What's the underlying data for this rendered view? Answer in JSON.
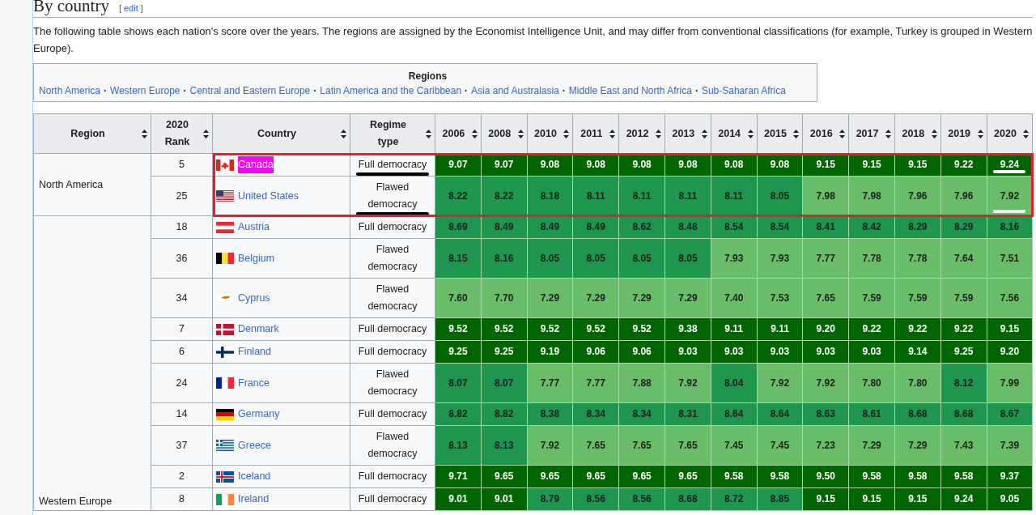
{
  "heading": {
    "title": "By country",
    "edit_brackets": [
      "[",
      "]"
    ],
    "edit_link": "edit"
  },
  "intro": "The following table shows each nation's score over the years. The regions are assigned by the Economist Intelligence Unit, and may differ from conventional classifications (for example, Turkey is grouped in Western Europe).",
  "regions_box": {
    "title": "Regions",
    "separator": "·",
    "links": [
      "North America",
      "Western Europe",
      "Central and Eastern Europe",
      "Latin America and the Caribbean",
      "Asia and Australasia",
      "Middle East and North Africa",
      "Sub-Saharan Africa"
    ]
  },
  "table": {
    "columns": [
      "Region",
      "2020 Rank",
      "Country",
      "Regime type",
      "2006",
      "2008",
      "2010",
      "2011",
      "2012",
      "2013",
      "2014",
      "2015",
      "2016",
      "2017",
      "2018",
      "2019",
      "2020"
    ],
    "regions": [
      {
        "name": "North America",
        "rows": [
          {
            "rank": "5",
            "country": "Canada",
            "flag": {
              "kind": "ca"
            },
            "highlighted": true,
            "regime": "Full democracy",
            "regime_underlined": true,
            "boxed": true,
            "scores": [
              {
                "v": "9.07",
                "color": "#006400"
              },
              {
                "v": "9.07",
                "color": "#006400"
              },
              {
                "v": "9.08",
                "color": "#006400"
              },
              {
                "v": "9.08",
                "color": "#006400"
              },
              {
                "v": "9.08",
                "color": "#006400"
              },
              {
                "v": "9.08",
                "color": "#006400"
              },
              {
                "v": "9.08",
                "color": "#006400"
              },
              {
                "v": "9.08",
                "color": "#006400"
              },
              {
                "v": "9.15",
                "color": "#006400"
              },
              {
                "v": "9.15",
                "color": "#006400"
              },
              {
                "v": "9.15",
                "color": "#006400"
              },
              {
                "v": "9.22",
                "color": "#006400"
              },
              {
                "v": "9.24",
                "color": "#006400",
                "underlined": true
              }
            ]
          },
          {
            "rank": "25",
            "country": "United States",
            "flag": {
              "kind": "us"
            },
            "highlighted": false,
            "regime": "Flawed democracy",
            "regime_underlined": true,
            "boxed": true,
            "scores": [
              {
                "v": "8.22",
                "color": "#1e9650"
              },
              {
                "v": "8.22",
                "color": "#1e9650"
              },
              {
                "v": "8.18",
                "color": "#1e9650"
              },
              {
                "v": "8.11",
                "color": "#1e9650"
              },
              {
                "v": "8.11",
                "color": "#1e9650"
              },
              {
                "v": "8.11",
                "color": "#1e9650"
              },
              {
                "v": "8.11",
                "color": "#1e9650"
              },
              {
                "v": "8.05",
                "color": "#1e9650"
              },
              {
                "v": "7.98",
                "color": "#69bd69"
              },
              {
                "v": "7.98",
                "color": "#69bd69"
              },
              {
                "v": "7.96",
                "color": "#69bd69"
              },
              {
                "v": "7.96",
                "color": "#69bd69"
              },
              {
                "v": "7.92",
                "color": "#69bd69",
                "underlined": true
              }
            ]
          }
        ]
      },
      {
        "name": "Western Europe",
        "rows": [
          {
            "rank": "18",
            "country": "Austria",
            "flag": {
              "kind": "at"
            },
            "highlighted": false,
            "regime": "Full democracy",
            "regime_underlined": false,
            "boxed": false,
            "scores": [
              {
                "v": "8.69",
                "color": "#1e9650"
              },
              {
                "v": "8.49",
                "color": "#1e9650"
              },
              {
                "v": "8.49",
                "color": "#1e9650"
              },
              {
                "v": "8.49",
                "color": "#1e9650"
              },
              {
                "v": "8.62",
                "color": "#1e9650"
              },
              {
                "v": "8.48",
                "color": "#1e9650"
              },
              {
                "v": "8.54",
                "color": "#1e9650"
              },
              {
                "v": "8.54",
                "color": "#1e9650"
              },
              {
                "v": "8.41",
                "color": "#1e9650"
              },
              {
                "v": "8.42",
                "color": "#1e9650"
              },
              {
                "v": "8.29",
                "color": "#1e9650"
              },
              {
                "v": "8.29",
                "color": "#1e9650"
              },
              {
                "v": "8.16",
                "color": "#1e9650"
              }
            ]
          },
          {
            "rank": "36",
            "country": "Belgium",
            "flag": {
              "kind": "be"
            },
            "highlighted": false,
            "regime": "Flawed democracy",
            "regime_underlined": false,
            "boxed": false,
            "scores": [
              {
                "v": "8.15",
                "color": "#1e9650"
              },
              {
                "v": "8.16",
                "color": "#1e9650"
              },
              {
                "v": "8.05",
                "color": "#1e9650"
              },
              {
                "v": "8.05",
                "color": "#1e9650"
              },
              {
                "v": "8.05",
                "color": "#1e9650"
              },
              {
                "v": "8.05",
                "color": "#1e9650"
              },
              {
                "v": "7.93",
                "color": "#69bd69"
              },
              {
                "v": "7.93",
                "color": "#69bd69"
              },
              {
                "v": "7.77",
                "color": "#69bd69"
              },
              {
                "v": "7.78",
                "color": "#69bd69"
              },
              {
                "v": "7.78",
                "color": "#69bd69"
              },
              {
                "v": "7.64",
                "color": "#69bd69"
              },
              {
                "v": "7.51",
                "color": "#69bd69"
              }
            ]
          },
          {
            "rank": "34",
            "country": "Cyprus",
            "flag": {
              "kind": "cy"
            },
            "highlighted": false,
            "regime": "Flawed democracy",
            "regime_underlined": false,
            "boxed": false,
            "scores": [
              {
                "v": "7.60",
                "color": "#69bd69"
              },
              {
                "v": "7.70",
                "color": "#69bd69"
              },
              {
                "v": "7.29",
                "color": "#69bd69"
              },
              {
                "v": "7.29",
                "color": "#69bd69"
              },
              {
                "v": "7.29",
                "color": "#69bd69"
              },
              {
                "v": "7.29",
                "color": "#69bd69"
              },
              {
                "v": "7.40",
                "color": "#69bd69"
              },
              {
                "v": "7.53",
                "color": "#69bd69"
              },
              {
                "v": "7.65",
                "color": "#69bd69"
              },
              {
                "v": "7.59",
                "color": "#69bd69"
              },
              {
                "v": "7.59",
                "color": "#69bd69"
              },
              {
                "v": "7.59",
                "color": "#69bd69"
              },
              {
                "v": "7.56",
                "color": "#69bd69"
              }
            ]
          },
          {
            "rank": "7",
            "country": "Denmark",
            "flag": {
              "kind": "dk"
            },
            "highlighted": false,
            "regime": "Full democracy",
            "regime_underlined": false,
            "boxed": false,
            "scores": [
              {
                "v": "9.52",
                "color": "#006400"
              },
              {
                "v": "9.52",
                "color": "#006400"
              },
              {
                "v": "9.52",
                "color": "#006400"
              },
              {
                "v": "9.52",
                "color": "#006400"
              },
              {
                "v": "9.52",
                "color": "#006400"
              },
              {
                "v": "9.38",
                "color": "#006400"
              },
              {
                "v": "9.11",
                "color": "#006400"
              },
              {
                "v": "9.11",
                "color": "#006400"
              },
              {
                "v": "9.20",
                "color": "#006400"
              },
              {
                "v": "9.22",
                "color": "#006400"
              },
              {
                "v": "9.22",
                "color": "#006400"
              },
              {
                "v": "9.22",
                "color": "#006400"
              },
              {
                "v": "9.15",
                "color": "#006400"
              }
            ]
          },
          {
            "rank": "6",
            "country": "Finland",
            "flag": {
              "kind": "fi"
            },
            "highlighted": false,
            "regime": "Full democracy",
            "regime_underlined": false,
            "boxed": false,
            "scores": [
              {
                "v": "9.25",
                "color": "#006400"
              },
              {
                "v": "9.25",
                "color": "#006400"
              },
              {
                "v": "9.19",
                "color": "#006400"
              },
              {
                "v": "9.06",
                "color": "#006400"
              },
              {
                "v": "9.06",
                "color": "#006400"
              },
              {
                "v": "9.03",
                "color": "#006400"
              },
              {
                "v": "9.03",
                "color": "#006400"
              },
              {
                "v": "9.03",
                "color": "#006400"
              },
              {
                "v": "9.03",
                "color": "#006400"
              },
              {
                "v": "9.03",
                "color": "#006400"
              },
              {
                "v": "9.14",
                "color": "#006400"
              },
              {
                "v": "9.25",
                "color": "#006400"
              },
              {
                "v": "9.20",
                "color": "#006400"
              }
            ]
          },
          {
            "rank": "24",
            "country": "France",
            "flag": {
              "kind": "fr"
            },
            "highlighted": false,
            "regime": "Flawed democracy",
            "regime_underlined": false,
            "boxed": false,
            "scores": [
              {
                "v": "8.07",
                "color": "#1e9650"
              },
              {
                "v": "8.07",
                "color": "#1e9650"
              },
              {
                "v": "7.77",
                "color": "#69bd69"
              },
              {
                "v": "7.77",
                "color": "#69bd69"
              },
              {
                "v": "7.88",
                "color": "#69bd69"
              },
              {
                "v": "7.92",
                "color": "#69bd69"
              },
              {
                "v": "8.04",
                "color": "#1e9650"
              },
              {
                "v": "7.92",
                "color": "#69bd69"
              },
              {
                "v": "7.92",
                "color": "#69bd69"
              },
              {
                "v": "7.80",
                "color": "#69bd69"
              },
              {
                "v": "7.80",
                "color": "#69bd69"
              },
              {
                "v": "8.12",
                "color": "#1e9650"
              },
              {
                "v": "7.99",
                "color": "#69bd69"
              }
            ]
          },
          {
            "rank": "14",
            "country": "Germany",
            "flag": {
              "kind": "de"
            },
            "highlighted": false,
            "regime": "Full democracy",
            "regime_underlined": false,
            "boxed": false,
            "scores": [
              {
                "v": "8.82",
                "color": "#1e9650"
              },
              {
                "v": "8.82",
                "color": "#1e9650"
              },
              {
                "v": "8.38",
                "color": "#1e9650"
              },
              {
                "v": "8.34",
                "color": "#1e9650"
              },
              {
                "v": "8.34",
                "color": "#1e9650"
              },
              {
                "v": "8.31",
                "color": "#1e9650"
              },
              {
                "v": "8.64",
                "color": "#1e9650"
              },
              {
                "v": "8.64",
                "color": "#1e9650"
              },
              {
                "v": "8.63",
                "color": "#1e9650"
              },
              {
                "v": "8.61",
                "color": "#1e9650"
              },
              {
                "v": "8.68",
                "color": "#1e9650"
              },
              {
                "v": "8.68",
                "color": "#1e9650"
              },
              {
                "v": "8.67",
                "color": "#1e9650"
              }
            ]
          },
          {
            "rank": "37",
            "country": "Greece",
            "flag": {
              "kind": "gr"
            },
            "highlighted": false,
            "regime": "Flawed democracy",
            "regime_underlined": false,
            "boxed": false,
            "scores": [
              {
                "v": "8.13",
                "color": "#1e9650"
              },
              {
                "v": "8.13",
                "color": "#1e9650"
              },
              {
                "v": "7.92",
                "color": "#69bd69"
              },
              {
                "v": "7.65",
                "color": "#69bd69"
              },
              {
                "v": "7.65",
                "color": "#69bd69"
              },
              {
                "v": "7.65",
                "color": "#69bd69"
              },
              {
                "v": "7.45",
                "color": "#69bd69"
              },
              {
                "v": "7.45",
                "color": "#69bd69"
              },
              {
                "v": "7.23",
                "color": "#69bd69"
              },
              {
                "v": "7.29",
                "color": "#69bd69"
              },
              {
                "v": "7.29",
                "color": "#69bd69"
              },
              {
                "v": "7.43",
                "color": "#69bd69"
              },
              {
                "v": "7.39",
                "color": "#69bd69"
              }
            ]
          },
          {
            "rank": "2",
            "country": "Iceland",
            "flag": {
              "kind": "is"
            },
            "highlighted": false,
            "regime": "Full democracy",
            "regime_underlined": false,
            "boxed": false,
            "scores": [
              {
                "v": "9.71",
                "color": "#006400"
              },
              {
                "v": "9.65",
                "color": "#006400"
              },
              {
                "v": "9.65",
                "color": "#006400"
              },
              {
                "v": "9.65",
                "color": "#006400"
              },
              {
                "v": "9.65",
                "color": "#006400"
              },
              {
                "v": "9.65",
                "color": "#006400"
              },
              {
                "v": "9.58",
                "color": "#006400"
              },
              {
                "v": "9.58",
                "color": "#006400"
              },
              {
                "v": "9.50",
                "color": "#006400"
              },
              {
                "v": "9.58",
                "color": "#006400"
              },
              {
                "v": "9.58",
                "color": "#006400"
              },
              {
                "v": "9.58",
                "color": "#006400"
              },
              {
                "v": "9.37",
                "color": "#006400"
              }
            ]
          },
          {
            "rank": "8",
            "country": "Ireland",
            "flag": {
              "kind": "ie"
            },
            "highlighted": false,
            "regime": "Full democracy",
            "regime_underlined": false,
            "boxed": false,
            "scores": [
              {
                "v": "9.01",
                "color": "#006400"
              },
              {
                "v": "9.01",
                "color": "#006400"
              },
              {
                "v": "8.79",
                "color": "#1e9650"
              },
              {
                "v": "8.56",
                "color": "#1e9650"
              },
              {
                "v": "8.56",
                "color": "#1e9650"
              },
              {
                "v": "8.68",
                "color": "#1e9650"
              },
              {
                "v": "8.72",
                "color": "#1e9650"
              },
              {
                "v": "8.85",
                "color": "#1e9650"
              },
              {
                "v": "9.15",
                "color": "#006400"
              },
              {
                "v": "9.15",
                "color": "#006400"
              },
              {
                "v": "9.15",
                "color": "#006400"
              },
              {
                "v": "9.24",
                "color": "#006400"
              },
              {
                "v": "9.05",
                "color": "#006400"
              }
            ]
          }
        ]
      }
    ]
  }
}
